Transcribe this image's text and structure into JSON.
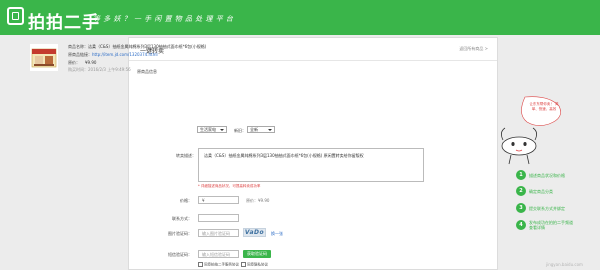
{
  "header": {
    "brand": "拍拍二手",
    "slogan": "等 多 妖 ？ 一 手 闲 置 物 品 处 理 平 台"
  },
  "panel": {
    "title": "一键转卖",
    "back_link": "返回所有商品 >",
    "section_label": "原商品信息"
  },
  "product": {
    "name_label": "商品名称：",
    "name": "洁柔（C&S）抽纸金属纯棉系列3层130抽抽式面巾纸*6包(小规格)",
    "link_label": "原商品链接：",
    "link": "http://item.jd.com/1320374.html",
    "price_label": "原价：",
    "price": "¥9.90",
    "time_label": "购买时间：",
    "time": "2016/2/3 上午9:49:56"
  },
  "form": {
    "category_label": "类目：",
    "category_value": "生活家电",
    "condition_label": "新旧：",
    "condition_value": "全新",
    "desc_label": "转卖描述：",
    "desc_value": "洁柔（C&S）抽纸金属纯棉系列3层130抽抽式面巾纸*6包(小规格) 原闲置转卖给你留版权",
    "desc_hint": "*  详细描述商品状况，可提高转卖成功率",
    "price_label": "价格：",
    "price_value": "¥",
    "orig_price": "原价：¥9.90",
    "contact_label": "联系方式：",
    "contact_value": "",
    "img_code_label": "图片验证码：",
    "img_code_placeholder": "输入图片验证码",
    "captcha_text": "VaDo",
    "swap_label": "换一张",
    "sms_code_label": "短信验证码：",
    "sms_code_placeholder": "输入短信验证码",
    "send_code_button": "获取验证码",
    "agree_1": "同意拍拍二手服务协议",
    "agree_2": "同意隐私协议"
  },
  "sidebar": {
    "bubble": "让东东帮你卖！ 简单、快速、高效",
    "steps": [
      {
        "num": "1",
        "text": "描述商品状况和价格"
      },
      {
        "num": "2",
        "text": "确定商品分类"
      },
      {
        "num": "3",
        "text": "提交联系方式并绑定"
      },
      {
        "num": "4",
        "text": "发布成功在拍拍二手频道查看详情"
      }
    ]
  },
  "watermark": "jingyan.baidu.com",
  "colors": {
    "brand_green": "#3ab54a",
    "link_blue": "#2a6bc6",
    "hint_red": "#d44444"
  }
}
